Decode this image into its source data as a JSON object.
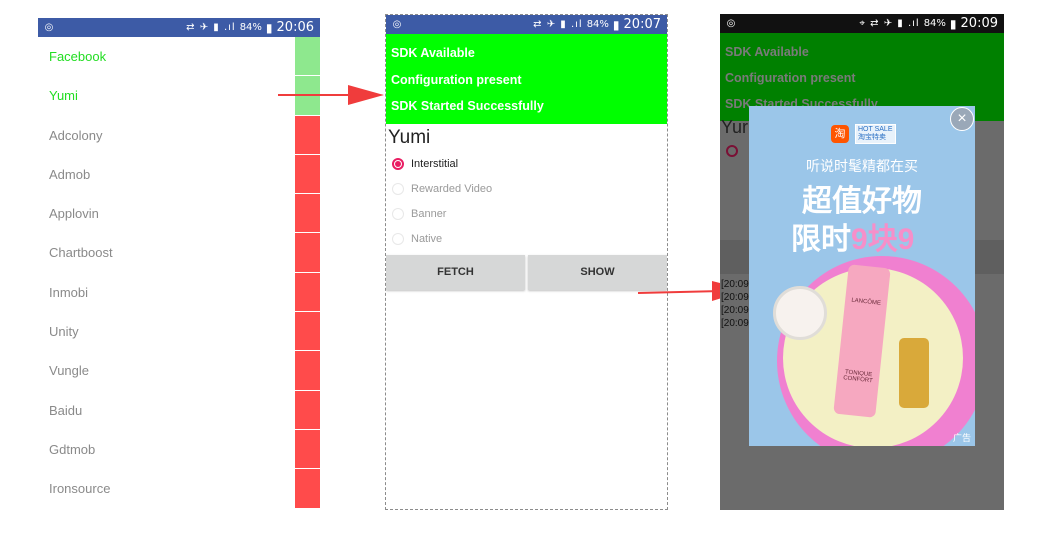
{
  "phone1": {
    "status": {
      "battery": "84%",
      "time": "20:06"
    },
    "sdks": [
      {
        "name": "Facebook",
        "active": true,
        "bar": "#8ee88e"
      },
      {
        "name": "Yumi",
        "active": true,
        "bar": "#8ee88e"
      },
      {
        "name": "Adcolony",
        "active": false,
        "bar": "#ff4b4b"
      },
      {
        "name": "Admob",
        "active": false,
        "bar": "#ff4b4b"
      },
      {
        "name": "Applovin",
        "active": false,
        "bar": "#ff4b4b"
      },
      {
        "name": "Chartboost",
        "active": false,
        "bar": "#ff4b4b"
      },
      {
        "name": "Inmobi",
        "active": false,
        "bar": "#ff4b4b"
      },
      {
        "name": "Unity",
        "active": false,
        "bar": "#ff4b4b"
      },
      {
        "name": "Vungle",
        "active": false,
        "bar": "#ff4b4b"
      },
      {
        "name": "Baidu",
        "active": false,
        "bar": "#ff4b4b"
      },
      {
        "name": "Gdtmob",
        "active": false,
        "bar": "#ff4b4b"
      },
      {
        "name": "Ironsource",
        "active": false,
        "bar": "#ff4b4b"
      }
    ]
  },
  "phone2": {
    "status": {
      "battery": "84%",
      "time": "20:07"
    },
    "banner": [
      "SDK Available",
      "Configuration present",
      "SDK Started Successfully"
    ],
    "title": "Yumi",
    "options": [
      {
        "label": "Interstitial",
        "selected": true
      },
      {
        "label": "Rewarded Video",
        "selected": false
      },
      {
        "label": "Banner",
        "selected": false
      },
      {
        "label": "Native",
        "selected": false
      }
    ],
    "fetch": "FETCH",
    "show": "SHOW"
  },
  "phone3": {
    "status": {
      "battery": "84%",
      "time": "20:09"
    },
    "banner": [
      "SDK Available",
      "Configuration present",
      "SDK Started Successfully"
    ],
    "title_partial": "Yur",
    "logs": [
      "[20:09",
      "[20:09",
      "[20:09",
      "[20:09"
    ],
    "ad": {
      "logo_char": "淘",
      "badge_top": "HOT SALE",
      "badge_bottom": "淘宝特卖",
      "line1": "听说时髦精都在买",
      "line2": "超值好物",
      "line3_prefix": "限时",
      "line3_highlight": "9块9",
      "tag": "广告",
      "close": "×",
      "product_brand": "LANCÔME",
      "product_name": "TONIQUE CONFORT"
    }
  },
  "colors": {
    "green": "#00ff00",
    "red": "#ff4b4b",
    "pink": "#e91e63",
    "statusbar": "#3d5ba6"
  }
}
